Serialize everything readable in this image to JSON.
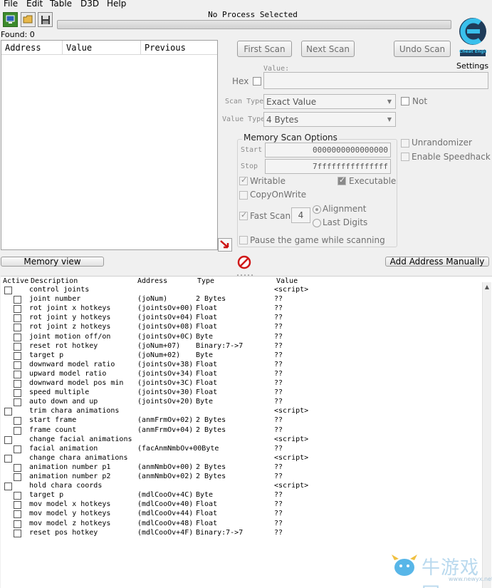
{
  "menu": [
    "File",
    "Edit",
    "Table",
    "D3D",
    "Help"
  ],
  "process_title": "No Process Selected",
  "found_label": "Found: 0",
  "settings_label": "Settings",
  "logo_text": "Cheat Engine",
  "found_list": {
    "columns": [
      "Address",
      "Value",
      "Previous"
    ]
  },
  "scan": {
    "first_scan": "First Scan",
    "next_scan": "Next Scan",
    "undo_scan": "Undo Scan",
    "value_label": "Value:",
    "hex_label": "Hex",
    "scan_type_label": "Scan Type",
    "scan_type_value": "Exact Value",
    "not_label": "Not",
    "value_type_label": "Value Type",
    "value_type_value": "4 Bytes"
  },
  "memory_scan_options": {
    "title": "Memory Scan Options",
    "start_label": "Start",
    "start_value": "0000000000000000",
    "stop_label": "Stop",
    "stop_value": "7fffffffffffffff",
    "writable": "Writable",
    "executable": "Executable",
    "copy_on_write": "CopyOnWrite",
    "fast_scan": "Fast Scan",
    "fast_scan_value": "4",
    "alignment": "Alignment",
    "last_digits": "Last Digits",
    "pause_game": "Pause the game while scanning"
  },
  "unrandomizer": "Unrandomizer",
  "enable_speedhack": "Enable Speedhack",
  "memory_view": "Memory view",
  "add_address_manually": "Add Address Manually",
  "table_headers": {
    "active": "Active",
    "description": "Description",
    "address": "Address",
    "type": "Type",
    "value": "Value"
  },
  "rows": [
    {
      "indent": 0,
      "description": "control joints",
      "address": "",
      "type": "",
      "value": "<script>"
    },
    {
      "indent": 1,
      "description": "joint number",
      "address": "(joNum)",
      "type": "2 Bytes",
      "value": "??"
    },
    {
      "indent": 1,
      "description": "rot joint x hotkeys",
      "address": "(jointsOv+00)",
      "type": "Float",
      "value": "??"
    },
    {
      "indent": 1,
      "description": "rot joint y hotkeys",
      "address": "(jointsOv+04)",
      "type": "Float",
      "value": "??"
    },
    {
      "indent": 1,
      "description": "rot joint z hotkeys",
      "address": "(jointsOv+08)",
      "type": "Float",
      "value": "??"
    },
    {
      "indent": 1,
      "description": "joint motion off/on",
      "address": "(jointsOv+0C)",
      "type": "Byte",
      "value": "??"
    },
    {
      "indent": 1,
      "description": "reset rot hotkey",
      "address": "(joNum+07)",
      "type": "Binary:7->7",
      "value": "??"
    },
    {
      "indent": 1,
      "description": "target p",
      "address": "(joNum+02)",
      "type": "Byte",
      "value": "??"
    },
    {
      "indent": 1,
      "description": "downward model ratio",
      "address": "(jointsOv+38)",
      "type": "Float",
      "value": "??"
    },
    {
      "indent": 1,
      "description": "upward model ratio",
      "address": "(jointsOv+34)",
      "type": "Float",
      "value": "??"
    },
    {
      "indent": 1,
      "description": "downward model pos min",
      "address": "(jointsOv+3C)",
      "type": "Float",
      "value": "??"
    },
    {
      "indent": 1,
      "description": "speed multiple",
      "address": "(jointsOv+30)",
      "type": "Float",
      "value": "??"
    },
    {
      "indent": 1,
      "description": "auto down and up",
      "address": "(jointsOv+20)",
      "type": "Byte",
      "value": "??"
    },
    {
      "indent": 0,
      "description": "trim chara animations",
      "address": "",
      "type": "",
      "value": "<script>"
    },
    {
      "indent": 1,
      "description": "start frame",
      "address": "(anmFrmOv+02)",
      "type": "2 Bytes",
      "value": "??"
    },
    {
      "indent": 1,
      "description": "frame count",
      "address": "(anmFrmOv+04)",
      "type": "2 Bytes",
      "value": "??"
    },
    {
      "indent": 0,
      "description": "change facial animations",
      "address": "",
      "type": "",
      "value": "<script>"
    },
    {
      "indent": 1,
      "description": "facial animation",
      "address": "(facAnmNmbOv+00Byte",
      "type": "",
      "value": "??"
    },
    {
      "indent": 0,
      "description": "change chara animations",
      "address": "",
      "type": "",
      "value": "<script>"
    },
    {
      "indent": 1,
      "description": "animation number p1",
      "address": "(anmNmbOv+00)",
      "type": "2 Bytes",
      "value": "??"
    },
    {
      "indent": 1,
      "description": "animation number p2",
      "address": "(anmNmbOv+02)",
      "type": "2 Bytes",
      "value": "??"
    },
    {
      "indent": 0,
      "description": "hold chara coords",
      "address": "",
      "type": "",
      "value": "<script>"
    },
    {
      "indent": 1,
      "description": "target p",
      "address": "(mdlCooOv+4C)",
      "type": "Byte",
      "value": "??"
    },
    {
      "indent": 1,
      "description": "mov model x hotkeys",
      "address": "(mdlCooOv+40)",
      "type": "Float",
      "value": "??"
    },
    {
      "indent": 1,
      "description": "mov model y hotkeys",
      "address": "(mdlCooOv+44)",
      "type": "Float",
      "value": "??"
    },
    {
      "indent": 1,
      "description": "mov model z hotkeys",
      "address": "(mdlCooOv+48)",
      "type": "Float",
      "value": "??"
    },
    {
      "indent": 1,
      "description": "reset pos hotkey",
      "address": "(mdlCooOv+4F)",
      "type": "Binary:7->7",
      "value": "??"
    }
  ],
  "watermark": {
    "text": "牛游戏网",
    "url": "www.newyx.net"
  }
}
